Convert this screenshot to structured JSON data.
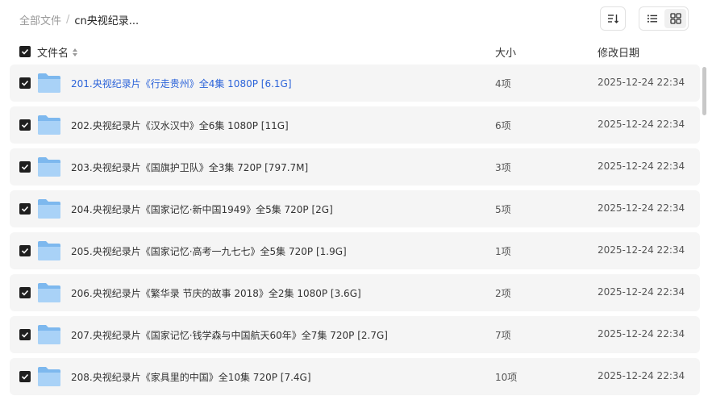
{
  "breadcrumb": {
    "root": "全部文件",
    "separator": "/",
    "current": "cn央视纪录..."
  },
  "header": {
    "name": "文件名",
    "size": "大小",
    "date": "修改日期"
  },
  "files": [
    {
      "name": "201.央视纪录片《行走贵州》全4集 1080P [6.1G]",
      "size": "4项",
      "date": "2025-12-24 22:34"
    },
    {
      "name": "202.央视纪录片《汉水汉中》全6集 1080P [11G]",
      "size": "6项",
      "date": "2025-12-24 22:34"
    },
    {
      "name": "203.央视纪录片《国旗护卫队》全3集 720P [797.7M]",
      "size": "3项",
      "date": "2025-12-24 22:34"
    },
    {
      "name": "204.央视纪录片《国家记忆·新中国1949》全5集 720P [2G]",
      "size": "5项",
      "date": "2025-12-24 22:34"
    },
    {
      "name": "205.央视纪录片《国家记忆·高考一九七七》全5集 720P [1.9G]",
      "size": "1项",
      "date": "2025-12-24 22:34"
    },
    {
      "name": "206.央视纪录片《繁华录 节庆的故事 2018》全2集 1080P [3.6G]",
      "size": "2项",
      "date": "2025-12-24 22:34"
    },
    {
      "name": "207.央视纪录片《国家记忆·钱学森与中国航天60年》全7集 720P [2.7G]",
      "size": "7项",
      "date": "2025-12-24 22:34"
    },
    {
      "name": "208.央视纪录片《家具里的中国》全10集 720P [7.4G]",
      "size": "10项",
      "date": "2025-12-24 22:34"
    }
  ]
}
